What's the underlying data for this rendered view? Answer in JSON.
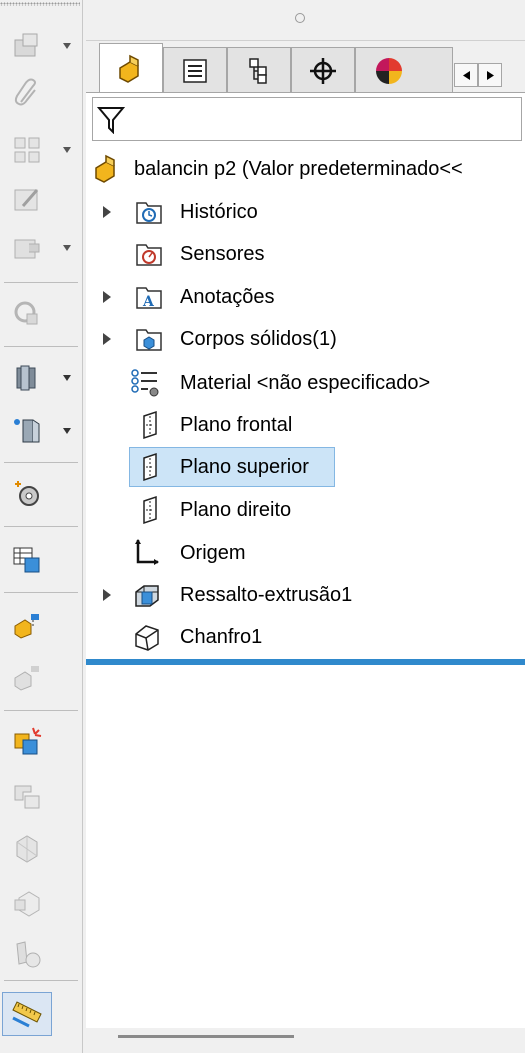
{
  "toolbar": {
    "buttons": [
      {
        "icon": "folder-document-icon",
        "has_arrow": true
      },
      {
        "icon": "paperclip-icon",
        "has_arrow": false
      },
      {
        "icon": "grid-pattern-icon",
        "has_arrow": true
      },
      {
        "icon": "edit-sketch-icon",
        "has_arrow": false
      },
      {
        "icon": "insert-part-icon",
        "has_arrow": true
      },
      {
        "icon": "rotate-component-icon",
        "has_arrow": false
      },
      {
        "icon": "move-face-icon",
        "has_arrow": true
      },
      {
        "icon": "reference-plane-icon",
        "has_arrow": true
      },
      {
        "icon": "gears-icon",
        "has_arrow": false
      },
      {
        "icon": "table-cube-icon",
        "has_arrow": false
      },
      {
        "icon": "part-flag-icon",
        "has_arrow": false
      },
      {
        "icon": "part-flag-disabled-icon",
        "has_arrow": false
      },
      {
        "icon": "interference-icon",
        "has_arrow": false
      },
      {
        "icon": "layout-icon",
        "has_arrow": false
      },
      {
        "icon": "cube-grid-icon",
        "has_arrow": false
      },
      {
        "icon": "cube-outline-icon",
        "has_arrow": false
      },
      {
        "icon": "motion-study-icon",
        "has_arrow": false
      },
      {
        "icon": "measure-ruler-icon",
        "has_arrow": false
      }
    ]
  },
  "tabs": [
    {
      "name": "featuremanager-tab",
      "icon": "part-tree-icon",
      "active": true
    },
    {
      "name": "propertymanager-tab",
      "icon": "property-list-icon",
      "active": false
    },
    {
      "name": "configurationmanager-tab",
      "icon": "configuration-icon",
      "active": false
    },
    {
      "name": "dimxpert-tab",
      "icon": "crosshair-icon",
      "active": false
    },
    {
      "name": "display-manager-tab",
      "icon": "color-wheel-icon",
      "active": false
    }
  ],
  "filter": {
    "icon": "funnel-icon",
    "value": ""
  },
  "tree": {
    "root": {
      "label": "balancin p2  (Valor predeterminado<<"
    },
    "items": [
      {
        "label": "Histórico",
        "icon": "history-folder-icon",
        "expandable": true,
        "selected": false
      },
      {
        "label": "Sensores",
        "icon": "sensor-folder-icon",
        "expandable": false,
        "selected": false
      },
      {
        "label": "Anotações",
        "icon": "annotations-folder-icon",
        "expandable": true,
        "selected": false
      },
      {
        "label": "Corpos sólidos(1)",
        "icon": "solid-bodies-folder-icon",
        "expandable": true,
        "selected": false
      },
      {
        "label": "Material <não especificado>",
        "icon": "material-icon",
        "expandable": false,
        "selected": false
      },
      {
        "label": "Plano frontal",
        "icon": "plane-icon",
        "expandable": false,
        "selected": false
      },
      {
        "label": "Plano superior",
        "icon": "plane-icon",
        "expandable": false,
        "selected": true
      },
      {
        "label": "Plano direito",
        "icon": "plane-icon",
        "expandable": false,
        "selected": false
      },
      {
        "label": "Origem",
        "icon": "origin-icon",
        "expandable": false,
        "selected": false
      },
      {
        "label": "Ressalto-extrusão1",
        "icon": "boss-extrude-icon",
        "expandable": true,
        "selected": false
      },
      {
        "label": "Chanfro1",
        "icon": "chamfer-icon",
        "expandable": false,
        "selected": false
      }
    ]
  },
  "colors": {
    "selection": "#cce4f7",
    "rollback_bar": "#2f89cc",
    "part_icon": "#f2b51d"
  }
}
